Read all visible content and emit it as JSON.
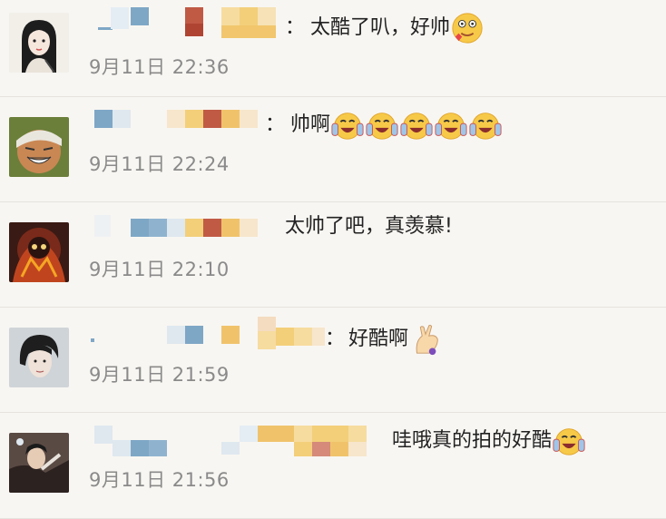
{
  "comments": [
    {
      "separator": "：",
      "text": "太酷了叭，好帅",
      "emojis": [
        "blush-smile"
      ],
      "time": "9月11日 22:36"
    },
    {
      "separator": "：",
      "text": "帅啊",
      "emojis": [
        "laugh-cry-thumbs",
        "laugh-cry-thumbs",
        "laugh-cry-thumbs",
        "laugh-cry-thumbs",
        "laugh-cry-thumbs"
      ],
      "time": "9月11日 22:24"
    },
    {
      "separator": "",
      "text": "太帅了吧，真羡慕!",
      "emojis": [],
      "time": "9月11日 22:10"
    },
    {
      "separator": "：",
      "text": "好酷啊",
      "emojis": [
        "ok-hand"
      ],
      "time": "9月11日 21:59"
    },
    {
      "separator": "",
      "text": "哇哦真的拍的好酷",
      "emojis": [
        "laugh-cry-thumbs"
      ],
      "time": "9月11日 21:56"
    }
  ],
  "colors": {
    "background": "#f8f6f2",
    "divider": "#e6e3de",
    "time": "#8a8a8a",
    "blur_blue": "#7ea7c6",
    "blur_orange": "#f0c36b",
    "blur_red": "#c05a45"
  }
}
